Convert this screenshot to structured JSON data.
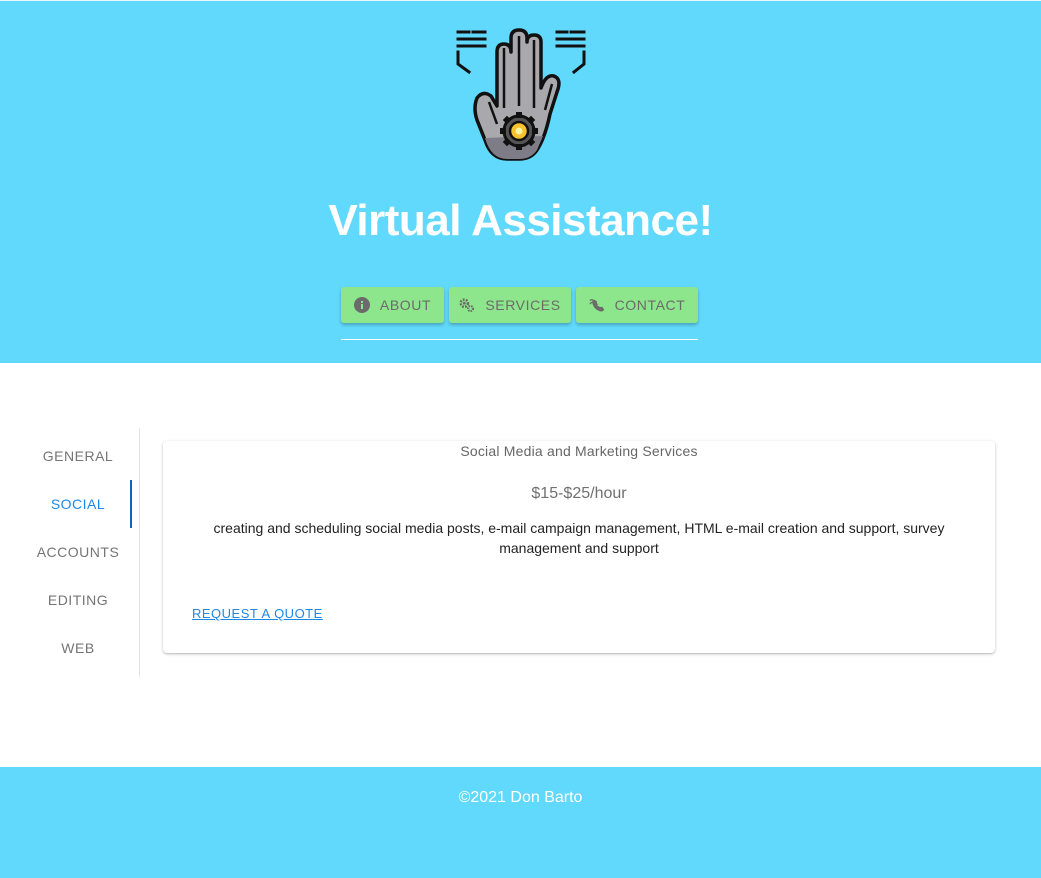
{
  "colors": {
    "header_bg": "#61d9fc",
    "nav_button_bg": "#8de68b",
    "accent": "#1e88e5",
    "footer_bg": "#61d9fc"
  },
  "header": {
    "logo_icon": "robot-hand-gear-icon",
    "title": "Virtual Assistance!",
    "nav": [
      {
        "label": "ABOUT",
        "icon": "info-icon"
      },
      {
        "label": "SERVICES",
        "icon": "gears-icon"
      },
      {
        "label": "CONTACT",
        "icon": "signal-phone-icon"
      }
    ]
  },
  "tabs": {
    "items": [
      "GENERAL",
      "SOCIAL",
      "ACCOUNTS",
      "EDITING",
      "WEB"
    ],
    "active": "SOCIAL"
  },
  "card": {
    "subtitle": "Social Media and Marketing Services",
    "price": "$15-$25/hour",
    "description": "creating and scheduling social media posts, e-mail campaign management, HTML e-mail creation and support, survey management and support",
    "link_label": "REQUEST A QUOTE"
  },
  "footer": {
    "text": "©2021 Don Barto"
  }
}
